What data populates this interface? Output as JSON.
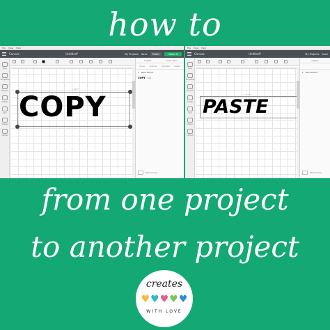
{
  "headline": {
    "top": "how to",
    "middle_line1": "from one project",
    "middle_line2": "to another project"
  },
  "app": {
    "menu_items": [
      "File",
      "View",
      "Help"
    ],
    "header_title": "Canvas",
    "document_title": "Untitled*",
    "my_projects": "My Projects",
    "save": "Save",
    "machine_select": "Maker",
    "make_it": "Make It"
  },
  "left_window": {
    "canvas_word": "COPY",
    "selection_label": "1.419\"",
    "panel_tabs": [
      "Layers",
      "Color Sync"
    ],
    "panel_tools": [
      "Group",
      "Ungroup",
      "Duplicate",
      "Delete"
    ],
    "layer_group": "Weld Result",
    "layer_name": "COPY",
    "layer_op": "Cut",
    "blank_canvas": "Blank Canvas"
  },
  "right_window": {
    "canvas_word": "PASTE",
    "selection_label": "1.419\"",
    "panel_tabs": [
      "Layers"
    ],
    "layer_group": "Weld Result",
    "blank_canvas": "Blank Canvas"
  },
  "left_sidebar": [
    "New",
    "Templates",
    "Projects",
    "Images",
    "Text",
    "Shapes",
    "Upload"
  ],
  "badge": {
    "top": "creates",
    "bottom": "WITH LOVE",
    "heart_colors": [
      "#f6b93b",
      "#2eb8c9",
      "#e55c8a",
      "#7ac65a",
      "#2e8bd6"
    ]
  },
  "colors": {
    "background": "#14a874",
    "accent_make_it": "#1fae63"
  }
}
